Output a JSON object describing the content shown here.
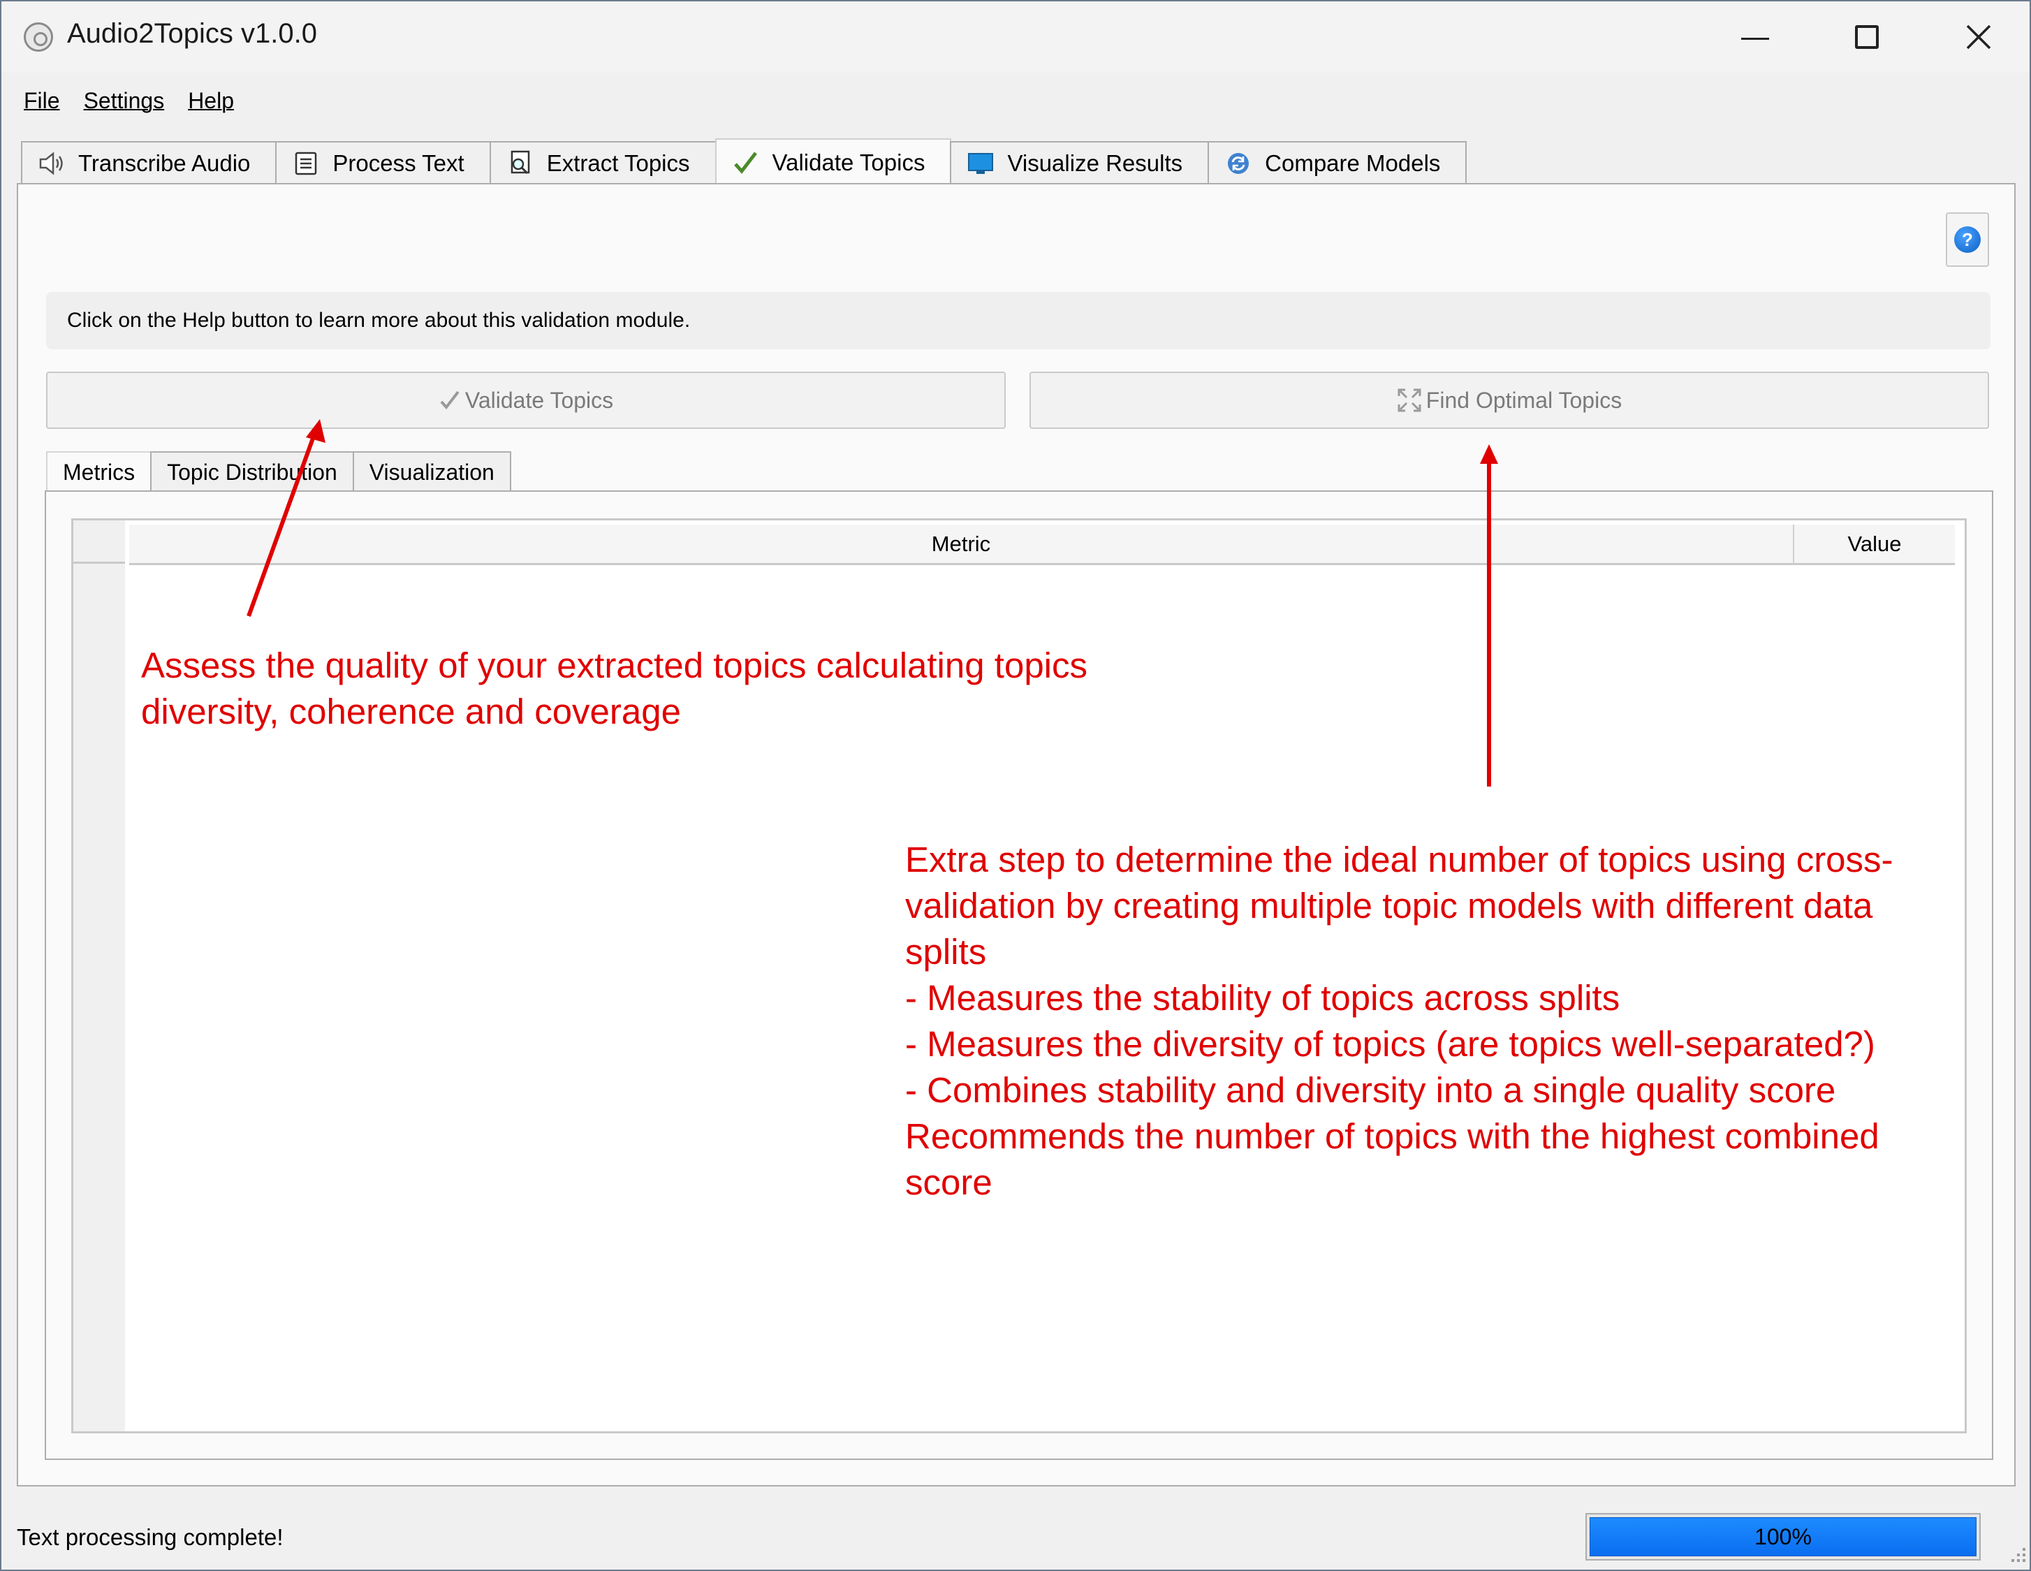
{
  "window": {
    "title": "Audio2Topics v1.0.0"
  },
  "menu": [
    "File",
    "Settings",
    "Help"
  ],
  "main_tabs": [
    {
      "label": "Transcribe Audio",
      "icon": "speaker-icon"
    },
    {
      "label": "Process Text",
      "icon": "document-icon"
    },
    {
      "label": "Extract Topics",
      "icon": "search-document-icon"
    },
    {
      "label": "Validate Topics",
      "icon": "checkmark-icon",
      "active": true
    },
    {
      "label": "Visualize Results",
      "icon": "monitor-icon"
    },
    {
      "label": "Compare Models",
      "icon": "refresh-icon"
    }
  ],
  "info_text": "Click on the Help button to learn more about this validation module.",
  "buttons": {
    "validate": "Validate Topics",
    "find_optimal": "Find Optimal Topics",
    "help": "?"
  },
  "sub_tabs": [
    {
      "label": "Metrics",
      "active": true
    },
    {
      "label": "Topic Distribution"
    },
    {
      "label": "Visualization"
    }
  ],
  "table": {
    "columns": [
      "Metric",
      "Value"
    ]
  },
  "annotations": {
    "validate_note": "Assess the quality of your extracted topics calculating topics\ndiversity, coherence and coverage",
    "optimal_note": "Extra step to determine the ideal number of topics using cross-\nvalidation by creating multiple topic models with different data\nsplits\n- Measures the stability of topics across splits\n- Measures the diversity of topics (are topics well-separated?)\n- Combines stability and diversity into a single quality score\nRecommends the number of topics with the highest combined\nscore"
  },
  "status": {
    "message": "Text processing complete!",
    "progress_label": "100%",
    "progress": 1.0
  },
  "colors": {
    "annotation": "#e00000",
    "progress": "#1e8bff"
  }
}
